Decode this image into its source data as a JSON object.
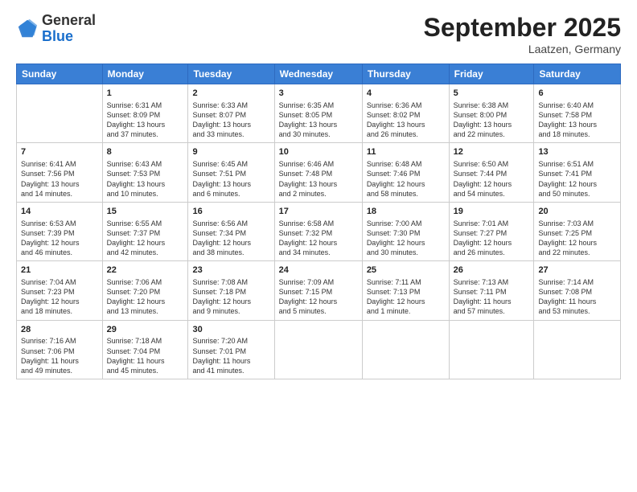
{
  "header": {
    "logo_general": "General",
    "logo_blue": "Blue",
    "month_title": "September 2025",
    "location": "Laatzen, Germany"
  },
  "days_of_week": [
    "Sunday",
    "Monday",
    "Tuesday",
    "Wednesday",
    "Thursday",
    "Friday",
    "Saturday"
  ],
  "weeks": [
    [
      {
        "day": "",
        "info": ""
      },
      {
        "day": "1",
        "info": "Sunrise: 6:31 AM\nSunset: 8:09 PM\nDaylight: 13 hours\nand 37 minutes."
      },
      {
        "day": "2",
        "info": "Sunrise: 6:33 AM\nSunset: 8:07 PM\nDaylight: 13 hours\nand 33 minutes."
      },
      {
        "day": "3",
        "info": "Sunrise: 6:35 AM\nSunset: 8:05 PM\nDaylight: 13 hours\nand 30 minutes."
      },
      {
        "day": "4",
        "info": "Sunrise: 6:36 AM\nSunset: 8:02 PM\nDaylight: 13 hours\nand 26 minutes."
      },
      {
        "day": "5",
        "info": "Sunrise: 6:38 AM\nSunset: 8:00 PM\nDaylight: 13 hours\nand 22 minutes."
      },
      {
        "day": "6",
        "info": "Sunrise: 6:40 AM\nSunset: 7:58 PM\nDaylight: 13 hours\nand 18 minutes."
      }
    ],
    [
      {
        "day": "7",
        "info": "Sunrise: 6:41 AM\nSunset: 7:56 PM\nDaylight: 13 hours\nand 14 minutes."
      },
      {
        "day": "8",
        "info": "Sunrise: 6:43 AM\nSunset: 7:53 PM\nDaylight: 13 hours\nand 10 minutes."
      },
      {
        "day": "9",
        "info": "Sunrise: 6:45 AM\nSunset: 7:51 PM\nDaylight: 13 hours\nand 6 minutes."
      },
      {
        "day": "10",
        "info": "Sunrise: 6:46 AM\nSunset: 7:48 PM\nDaylight: 13 hours\nand 2 minutes."
      },
      {
        "day": "11",
        "info": "Sunrise: 6:48 AM\nSunset: 7:46 PM\nDaylight: 12 hours\nand 58 minutes."
      },
      {
        "day": "12",
        "info": "Sunrise: 6:50 AM\nSunset: 7:44 PM\nDaylight: 12 hours\nand 54 minutes."
      },
      {
        "day": "13",
        "info": "Sunrise: 6:51 AM\nSunset: 7:41 PM\nDaylight: 12 hours\nand 50 minutes."
      }
    ],
    [
      {
        "day": "14",
        "info": "Sunrise: 6:53 AM\nSunset: 7:39 PM\nDaylight: 12 hours\nand 46 minutes."
      },
      {
        "day": "15",
        "info": "Sunrise: 6:55 AM\nSunset: 7:37 PM\nDaylight: 12 hours\nand 42 minutes."
      },
      {
        "day": "16",
        "info": "Sunrise: 6:56 AM\nSunset: 7:34 PM\nDaylight: 12 hours\nand 38 minutes."
      },
      {
        "day": "17",
        "info": "Sunrise: 6:58 AM\nSunset: 7:32 PM\nDaylight: 12 hours\nand 34 minutes."
      },
      {
        "day": "18",
        "info": "Sunrise: 7:00 AM\nSunset: 7:30 PM\nDaylight: 12 hours\nand 30 minutes."
      },
      {
        "day": "19",
        "info": "Sunrise: 7:01 AM\nSunset: 7:27 PM\nDaylight: 12 hours\nand 26 minutes."
      },
      {
        "day": "20",
        "info": "Sunrise: 7:03 AM\nSunset: 7:25 PM\nDaylight: 12 hours\nand 22 minutes."
      }
    ],
    [
      {
        "day": "21",
        "info": "Sunrise: 7:04 AM\nSunset: 7:23 PM\nDaylight: 12 hours\nand 18 minutes."
      },
      {
        "day": "22",
        "info": "Sunrise: 7:06 AM\nSunset: 7:20 PM\nDaylight: 12 hours\nand 13 minutes."
      },
      {
        "day": "23",
        "info": "Sunrise: 7:08 AM\nSunset: 7:18 PM\nDaylight: 12 hours\nand 9 minutes."
      },
      {
        "day": "24",
        "info": "Sunrise: 7:09 AM\nSunset: 7:15 PM\nDaylight: 12 hours\nand 5 minutes."
      },
      {
        "day": "25",
        "info": "Sunrise: 7:11 AM\nSunset: 7:13 PM\nDaylight: 12 hours\nand 1 minute."
      },
      {
        "day": "26",
        "info": "Sunrise: 7:13 AM\nSunset: 7:11 PM\nDaylight: 11 hours\nand 57 minutes."
      },
      {
        "day": "27",
        "info": "Sunrise: 7:14 AM\nSunset: 7:08 PM\nDaylight: 11 hours\nand 53 minutes."
      }
    ],
    [
      {
        "day": "28",
        "info": "Sunrise: 7:16 AM\nSunset: 7:06 PM\nDaylight: 11 hours\nand 49 minutes."
      },
      {
        "day": "29",
        "info": "Sunrise: 7:18 AM\nSunset: 7:04 PM\nDaylight: 11 hours\nand 45 minutes."
      },
      {
        "day": "30",
        "info": "Sunrise: 7:20 AM\nSunset: 7:01 PM\nDaylight: 11 hours\nand 41 minutes."
      },
      {
        "day": "",
        "info": ""
      },
      {
        "day": "",
        "info": ""
      },
      {
        "day": "",
        "info": ""
      },
      {
        "day": "",
        "info": ""
      }
    ]
  ]
}
